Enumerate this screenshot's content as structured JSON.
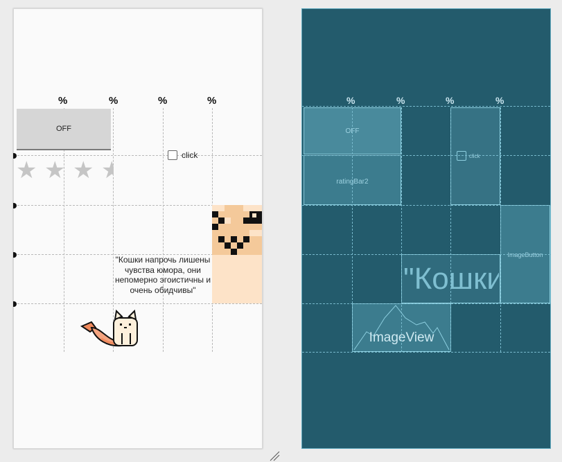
{
  "guidelines": {
    "percent_label": "%"
  },
  "design": {
    "toggle_label": "OFF",
    "checkbox_label": "click",
    "rating": {
      "stars_shown": 4,
      "filled": 0
    },
    "quote_text": "\"Кошки напрочь лишены чувства юмора, они непомерно эгоистичны и очень обидчивы\""
  },
  "blueprint": {
    "toggle_label": "OFF",
    "checkbox_label": "click",
    "rating_label": "ratingBar2",
    "image_button_label": "ImageButton",
    "quote_preview": "\"Кошки",
    "image_view_label": "ImageView"
  },
  "colors": {
    "blueprint_bg": "#235b6c",
    "blueprint_accent": "#8dcfe0",
    "design_bg": "#fafafa",
    "pixel_face": "#fde3c8",
    "cat_orange": "#f08a5d"
  }
}
